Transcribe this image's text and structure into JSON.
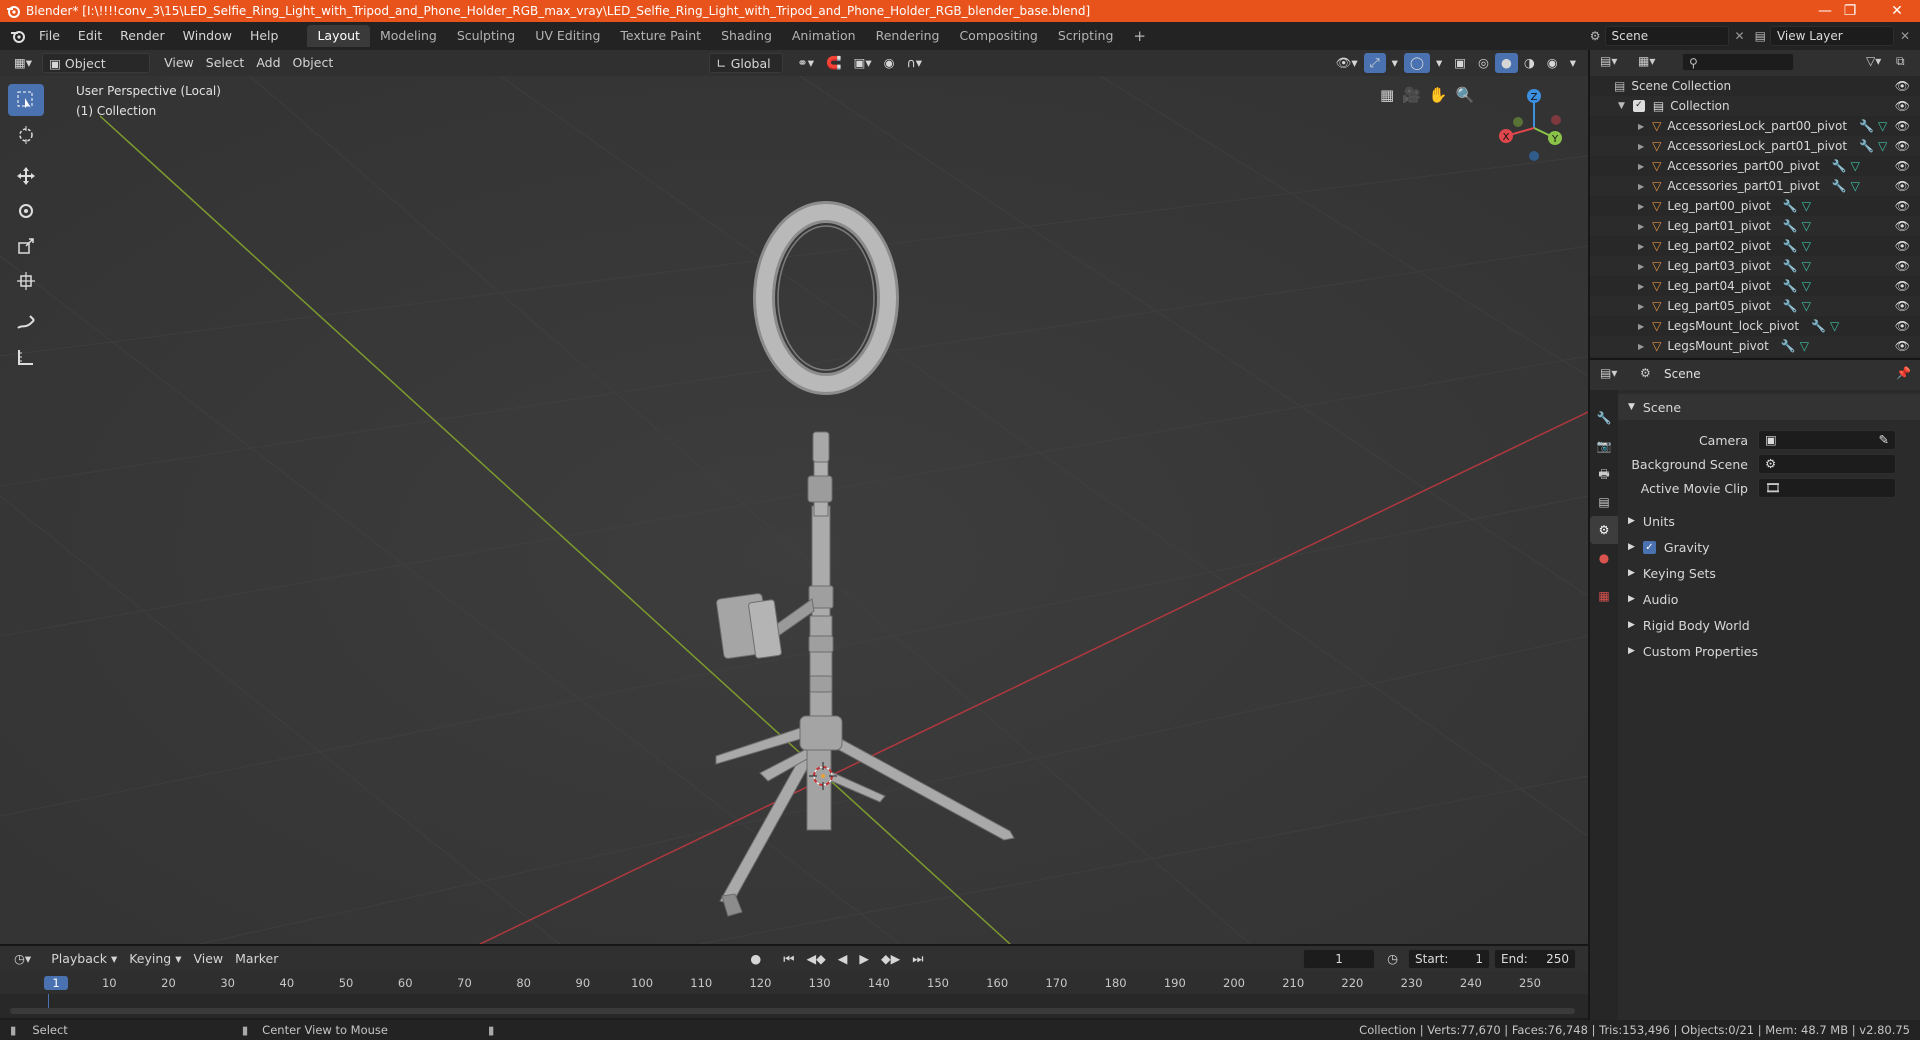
{
  "window": {
    "title": "Blender* [I:\\!!!!conv_3\\15\\LED_Selfie_Ring_Light_with_Tripod_and_Phone_Holder_RGB_max_vray\\LED_Selfie_Ring_Light_with_Tripod_and_Phone_Holder_RGB_blender_base.blend]"
  },
  "menubar": {
    "items": [
      "File",
      "Edit",
      "Render",
      "Window",
      "Help"
    ],
    "workspaces": [
      "Layout",
      "Modeling",
      "Sculpting",
      "UV Editing",
      "Texture Paint",
      "Shading",
      "Animation",
      "Rendering",
      "Compositing",
      "Scripting"
    ],
    "active_workspace": "Layout",
    "scene": "Scene",
    "view_layer": "View Layer"
  },
  "viewport_header": {
    "mode": "Object Mode",
    "menus": [
      "View",
      "Select",
      "Add",
      "Object"
    ],
    "transform_orientation": "Global"
  },
  "viewport": {
    "perspective_label": "User Perspective (Local)",
    "collection_label": "(1) Collection",
    "gizmo_axes": [
      "Z",
      "Y",
      "X"
    ]
  },
  "outliner": {
    "search_placeholder": "",
    "root": "Scene Collection",
    "collection": "Collection",
    "objects": [
      "AccessoriesLock_part00_pivot",
      "AccessoriesLock_part01_pivot",
      "Accessories_part00_pivot",
      "Accessories_part01_pivot",
      "Leg_part00_pivot",
      "Leg_part01_pivot",
      "Leg_part02_pivot",
      "Leg_part03_pivot",
      "Leg_part04_pivot",
      "Leg_part05_pivot",
      "LegsMount_lock_pivot",
      "LegsMount_pivot"
    ]
  },
  "properties": {
    "header_title": "Scene",
    "panel_scene": "Scene",
    "fields": [
      {
        "label": "Camera",
        "value": ""
      },
      {
        "label": "Background Scene",
        "value": ""
      },
      {
        "label": "Active Movie Clip",
        "value": ""
      }
    ],
    "sections": [
      "Units",
      "Gravity",
      "Keying Sets",
      "Audio",
      "Rigid Body World",
      "Custom Properties"
    ],
    "gravity_checked": true
  },
  "timeline": {
    "menus": [
      "Playback",
      "Keying",
      "View",
      "Marker"
    ],
    "current_frame": "1",
    "start_label": "Start:",
    "start": "1",
    "end_label": "End:",
    "end": "250",
    "ruler": [
      "1",
      "10",
      "20",
      "30",
      "40",
      "50",
      "60",
      "70",
      "80",
      "90",
      "100",
      "110",
      "120",
      "130",
      "140",
      "150",
      "160",
      "170",
      "180",
      "190",
      "200",
      "210",
      "220",
      "230",
      "240",
      "250"
    ]
  },
  "statusbar": {
    "select": "Select",
    "center_view": "Center View to Mouse",
    "stats": "Collection | Verts:77,670 | Faces:76,748 | Tris:153,496 | Objects:0/21 | Mem: 48.7 MB | v2.80.75"
  },
  "colors": {
    "titlebar": "#e8531c",
    "accent_blue": "#4a72b0",
    "axis_x": "#e0474c",
    "axis_y": "#8bc34a",
    "axis_z": "#3d8fe0",
    "object_orange": "#e6913c",
    "mesh_green": "#3fbfa4"
  }
}
